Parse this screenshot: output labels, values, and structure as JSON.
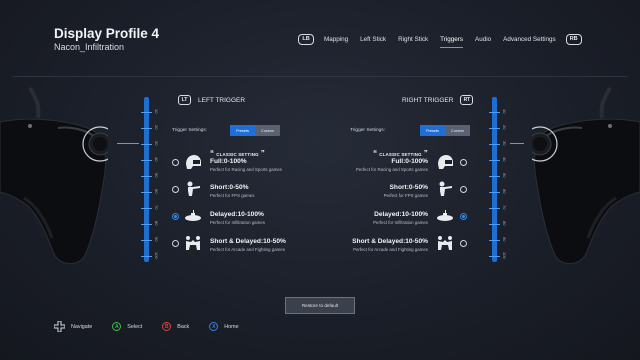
{
  "header": {
    "title": "Display Profile 4",
    "subtitle": "Nacon_Infiltration"
  },
  "nav": {
    "left_bumper": "LB",
    "right_bumper": "RB",
    "tabs": [
      {
        "label": "Mapping",
        "active": false
      },
      {
        "label": "Left Stick",
        "active": false
      },
      {
        "label": "Right Stick",
        "active": false
      },
      {
        "label": "Triggers",
        "active": true
      },
      {
        "label": "Audio",
        "active": false
      },
      {
        "label": "Advanced Settings",
        "active": false
      }
    ]
  },
  "scale": {
    "labels": [
      "10",
      "20",
      "30",
      "40",
      "50",
      "60",
      "70",
      "80",
      "90",
      "100"
    ]
  },
  "left_trigger": {
    "badge": "LT",
    "title": "LEFT TRIGGER",
    "settings_label": "Trigger Settings:",
    "presets_label": "Presets",
    "custom_label": "Custom",
    "selected_mode": "Presets",
    "selected_option": 2,
    "options": [
      {
        "badge": "CLASSIC SETTING",
        "name": "Full:0-100%",
        "desc": "Perfect for Racing and Sports games",
        "icon": "helmet-icon"
      },
      {
        "badge": "",
        "name": "Short:0-50%",
        "desc": "Perfect for FPS games",
        "icon": "shooter-icon"
      },
      {
        "badge": "",
        "name": "Delayed:10-100%",
        "desc": "Perfect for Infiltration games",
        "icon": "submarine-icon"
      },
      {
        "badge": "",
        "name": "Short & Delayed:10-50%",
        "desc": "Perfect for Arcade and Fighting games",
        "icon": "fighters-icon"
      }
    ]
  },
  "right_trigger": {
    "badge": "RT",
    "title": "RIGHT TRIGGER",
    "settings_label": "Trigger Settings:",
    "presets_label": "Presets",
    "custom_label": "Custom",
    "selected_mode": "Presets",
    "selected_option": 2,
    "options": [
      {
        "badge": "CLASSIC SETTING",
        "name": "Full:0-100%",
        "desc": "Perfect for Racing and Sports games",
        "icon": "helmet-icon"
      },
      {
        "badge": "",
        "name": "Short:0-50%",
        "desc": "Perfect for FPS games",
        "icon": "shooter-icon"
      },
      {
        "badge": "",
        "name": "Delayed:10-100%",
        "desc": "Perfect for Infiltration games",
        "icon": "submarine-icon"
      },
      {
        "badge": "",
        "name": "Short & Delayed:10-50%",
        "desc": "Perfect for Arcade and Fighting games",
        "icon": "fighters-icon"
      }
    ]
  },
  "restore_label": "Restore to default",
  "footer": {
    "navigate": "Navigate",
    "select": "Select",
    "back": "Back",
    "home": "Home",
    "select_key": "A",
    "back_key": "B",
    "home_key": "X",
    "select_color": "#3fbf4a",
    "back_color": "#e0413c",
    "home_color": "#3a7fe0"
  },
  "colors": {
    "accent": "#1f6fd6",
    "scale": "#1d6fd2"
  }
}
